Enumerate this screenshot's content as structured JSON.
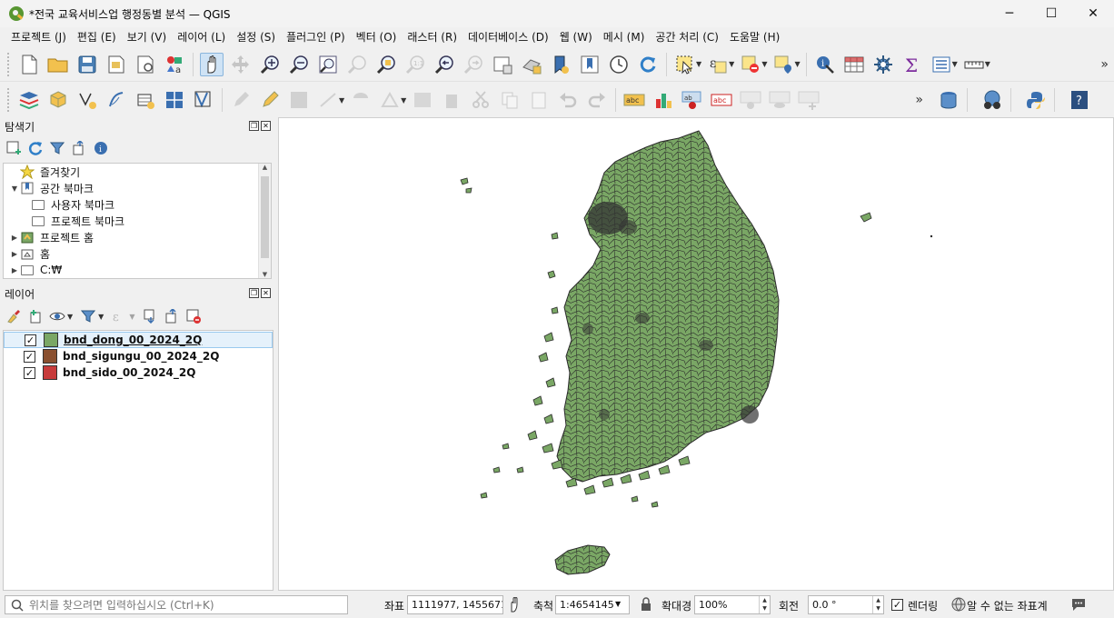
{
  "window": {
    "title": "*전국 교육서비스업 행정동별 분석 — QGIS",
    "minimize": "─",
    "maximize": "☐",
    "close": "✕"
  },
  "menu": [
    "프로젝트 (J)",
    "편집 (E)",
    "보기 (V)",
    "레이어 (L)",
    "설정 (S)",
    "플러그인 (P)",
    "벡터 (O)",
    "래스터 (R)",
    "데이터베이스 (D)",
    "웹 (W)",
    "메시 (M)",
    "공간 처리 (C)",
    "도움말 (H)"
  ],
  "toolbar1": {
    "icons": [
      "new-project-icon",
      "open-project-icon",
      "save-project-icon",
      "new-print-layout-icon",
      "layout-manager-icon",
      "style-manager-icon",
      "pan-icon",
      "pan-to-selection-icon",
      "zoom-in-icon",
      "zoom-out-icon",
      "zoom-full-icon",
      "zoom-to-selection-icon",
      "zoom-to-layer-icon",
      "zoom-native-icon",
      "zoom-last-icon",
      "zoom-next-icon",
      "new-map-view-icon",
      "new-3d-view-icon",
      "new-bookmark-icon",
      "show-bookmarks-icon",
      "temporal-controller-icon",
      "refresh-icon",
      "select-features-icon",
      "select-by-expression-icon",
      "deselect-icon",
      "select-by-location-icon",
      "identify-icon",
      "attribute-table-icon",
      "processing-toolbox-icon",
      "statistics-icon",
      "open-field-calculator-icon",
      "measure-icon"
    ],
    "more": "»"
  },
  "toolbar2": {
    "icons": [
      "data-source-manager-icon",
      "new-geopackage-icon",
      "new-shapefile-icon",
      "new-spatialite-icon",
      "new-virtual-layer-icon",
      "new-temporary-layer-icon",
      "new-mesh-layer-icon",
      "current-edits-icon",
      "toggle-editing-icon",
      "save-edits-icon",
      "digitize-icon",
      "add-feature-icon",
      "vertex-tool-icon",
      "modify-attributes-icon",
      "delete-selected-icon",
      "cut-features-icon",
      "copy-features-icon",
      "paste-features-icon",
      "undo-icon",
      "redo-icon",
      "label-tool-icon",
      "diagram-icon",
      "pin-label-icon",
      "highlight-label-icon",
      "show-hide-labels-icon",
      "move-label-icon",
      "rotate-label-icon",
      "db-manager-icon",
      "metasearch-icon",
      "python-console-icon",
      "help-icon"
    ],
    "more": "»"
  },
  "browser": {
    "title": "탐색기",
    "items": [
      {
        "label": "즐겨찾기",
        "icon": "favorites-star-icon",
        "arrow": ""
      },
      {
        "label": "공간 북마크",
        "icon": "spatial-bookmarks-icon",
        "arrow": "▼"
      },
      {
        "label": "사용자 북마크",
        "icon": "folder-icon",
        "arrow": ""
      },
      {
        "label": "프로젝트 북마크",
        "icon": "folder-icon",
        "arrow": ""
      },
      {
        "label": "프로젝트 홈",
        "icon": "project-home-icon",
        "arrow": "▶"
      },
      {
        "label": "홈",
        "icon": "home-icon",
        "arrow": "▶"
      },
      {
        "label": "C:₩",
        "icon": "drive-icon",
        "arrow": "▶"
      }
    ]
  },
  "layers_panel": {
    "title": "레이어",
    "layers": [
      {
        "name": "bnd_dong_00_2024_2Q",
        "color": "#7aa765",
        "checked": "✓"
      },
      {
        "name": "bnd_sigungu_00_2024_2Q",
        "color": "#8a5030",
        "checked": "✓"
      },
      {
        "name": "bnd_sido_00_2024_2Q",
        "color": "#c83c3c",
        "checked": "✓"
      }
    ]
  },
  "map": {
    "fill_color": "#7aa765",
    "stroke_color": "#2a2a2a"
  },
  "statusbar": {
    "locator_placeholder": "위치를 찾으려면 입력하십시오 (Ctrl+K)",
    "coord_label": "좌표",
    "coord_value": "1111977, 1455671",
    "scale_label": "축척",
    "scale_value": "1:4654145",
    "magnifier_label": "확대경",
    "magnifier_value": "100%",
    "rotation_label": "회전",
    "rotation_value": "0.0 °",
    "render_label": "렌더링",
    "render_checked": "✓",
    "crs_label": "알 수 없는 좌표계"
  }
}
